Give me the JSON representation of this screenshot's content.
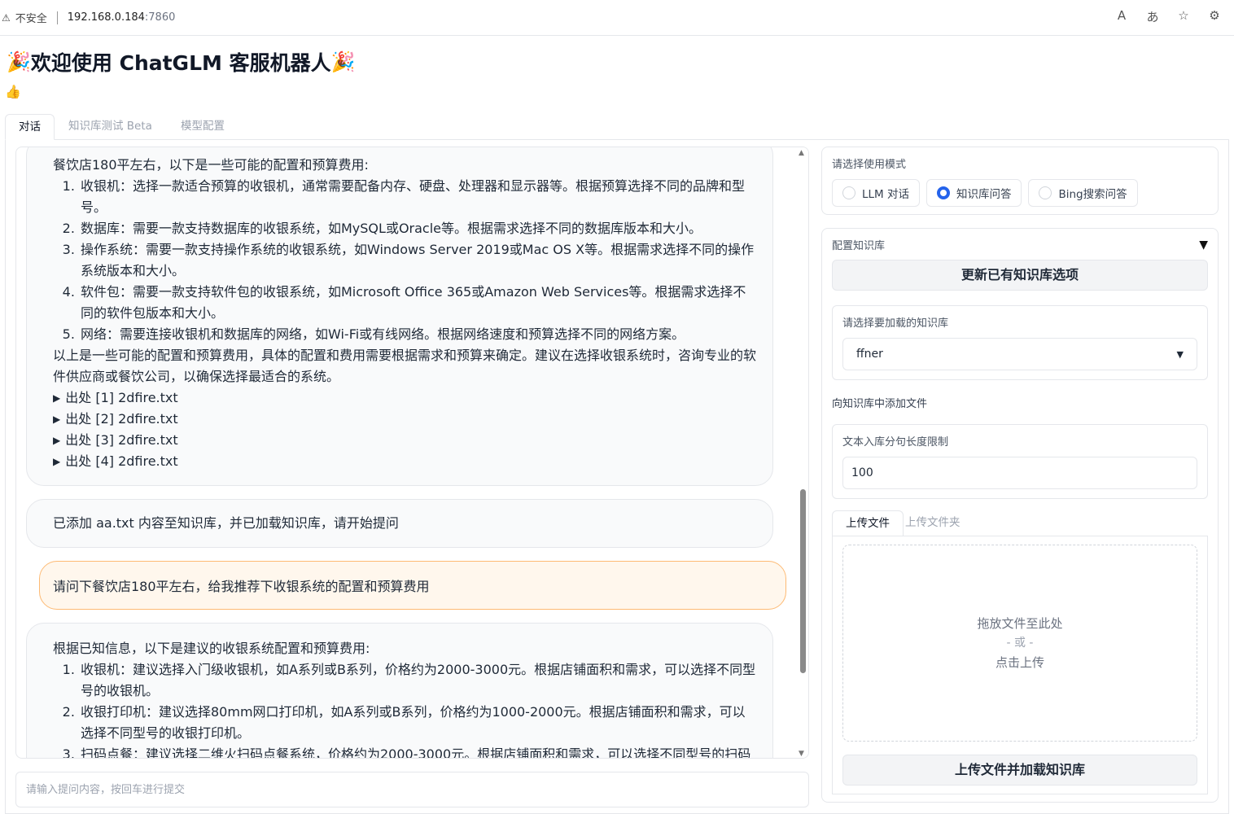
{
  "browser": {
    "security_label": "不安全",
    "url_host": "192.168.0.184",
    "url_port": ":7860"
  },
  "header": {
    "title": "欢迎使用 ChatGLM 客服机器人",
    "party_emoji": "🎉",
    "thumb_emoji": "👍"
  },
  "tabs": [
    {
      "label": "对话",
      "active": true
    },
    {
      "label": "知识库测试 Beta",
      "active": false
    },
    {
      "label": "模型配置",
      "active": false
    }
  ],
  "chat": {
    "messages": [
      {
        "role": "bot",
        "intro": "餐饮店180平左右，以下是一些可能的配置和预算费用:",
        "items": [
          "收银机：选择一款适合预算的收银机，通常需要配备内存、硬盘、处理器和显示器等。根据预算选择不同的品牌和型号。",
          "数据库：需要一款支持数据库的收银系统，如MySQL或Oracle等。根据需求选择不同的数据库版本和大小。",
          "操作系统：需要一款支持操作系统的收银系统，如Windows Server 2019或Mac OS X等。根据需求选择不同的操作系统版本和大小。",
          "软件包：需要一款支持软件包的收银系统，如Microsoft Office 365或Amazon Web Services等。根据需求选择不同的软件包版本和大小。",
          "网络：需要连接收银机和数据库的网络，如Wi-Fi或有线网络。根据网络速度和预算选择不同的网络方案。"
        ],
        "outro": "以上是一些可能的配置和预算费用，具体的配置和费用需要根据需求和预算来确定。建议在选择收银系统时，咨询专业的软件供应商或餐饮公司，以确保选择最适合的系统。",
        "sources": [
          "出处 [1] 2dfire.txt",
          "出处 [2] 2dfire.txt",
          "出处 [3] 2dfire.txt",
          "出处 [4] 2dfire.txt"
        ]
      },
      {
        "role": "bot",
        "text": "已添加 aa.txt 内容至知识库，并已加载知识库，请开始提问"
      },
      {
        "role": "user",
        "text": "请问下餐饮店180平左右，给我推荐下收银系统的配置和预算费用"
      },
      {
        "role": "bot",
        "intro": "根据已知信息，以下是建议的收银系统配置和预算费用:",
        "items": [
          "收银机：建议选择入门级收银机，如A系列或B系列，价格约为2000-3000元。根据店铺面积和需求，可以选择不同型号的收银机。",
          "收银打印机：建议选择80mm网口打印机，如A系列或B系列，价格约为1000-2000元。根据店铺面积和需求，可以选择不同型号的收银打印机。",
          "扫码点餐：建议选择二维火扫码点餐系统，价格约为2000-3000元。根据店铺面积和需求，可以选择不同型号的扫码点"
        ]
      }
    ],
    "input_placeholder": "请输入提问内容，按回车进行提交"
  },
  "mode": {
    "label": "请选择使用模式",
    "options": [
      {
        "label": "LLM 对话",
        "checked": false
      },
      {
        "label": "知识库问答",
        "checked": true
      },
      {
        "label": "Bing搜索问答",
        "checked": false
      }
    ]
  },
  "kb": {
    "section_label": "配置知识库",
    "refresh_button": "更新已有知识库选项",
    "select_label": "请选择要加载的知识库",
    "select_value": "ffner",
    "add_file_label": "向知识库中添加文件",
    "sentence_len_label": "文本入库分句长度限制",
    "sentence_len_value": "100",
    "upload_tabs": [
      {
        "label": "上传文件",
        "active": true
      },
      {
        "label": "上传文件夹",
        "active": false
      }
    ],
    "drop_text": "拖放文件至此处",
    "drop_or": "- 或 -",
    "drop_click": "点击上传",
    "upload_button": "上传文件并加载知识库"
  }
}
